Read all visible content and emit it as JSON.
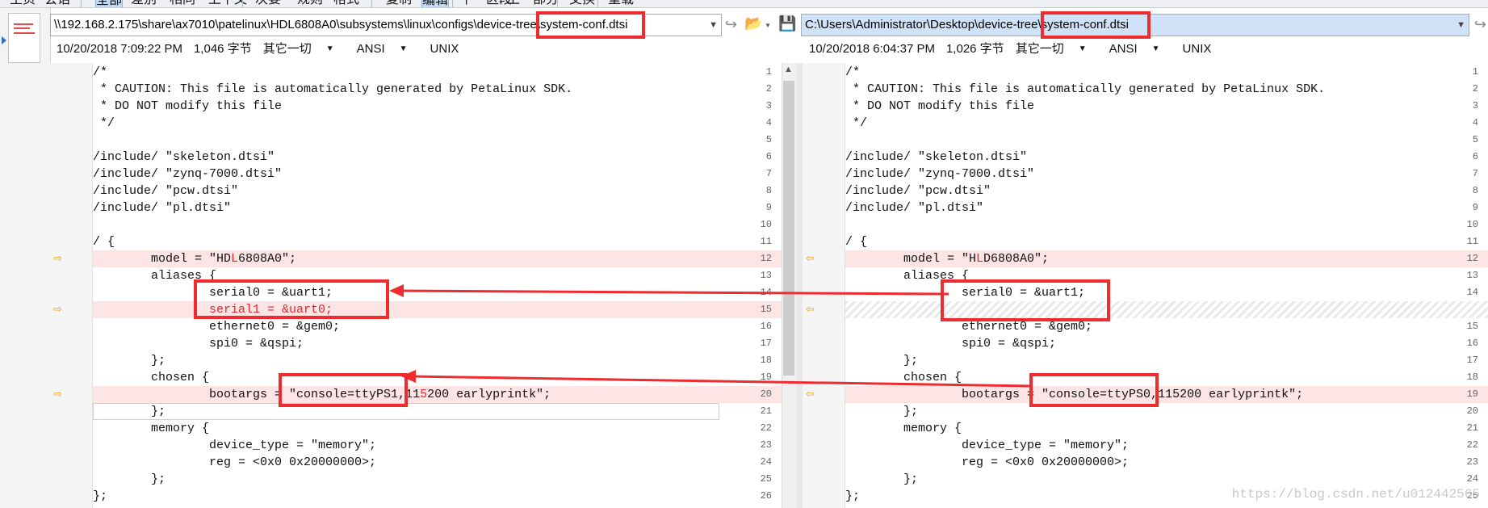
{
  "toolbar": {
    "buttons": [
      "主页",
      "会话",
      "全部",
      "差别",
      "相同",
      "上下文",
      "次要",
      "规则",
      "格式",
      "复制",
      "编辑",
      "下一区段",
      "上一部分",
      "交换",
      "重载"
    ],
    "selected": [
      "全部",
      "编辑"
    ]
  },
  "left_pane": {
    "path_prefix": "\\\\192.168.2.175\\share\\ax7010\\patelinux\\HDL6808A0\\subsystems\\linux\\configs\\device-tree\\",
    "path_file": "system-conf.dtsi",
    "timestamp": "10/20/2018 7:09:22 PM",
    "size": "1,046 字节",
    "other": "其它一切",
    "encoding": "ANSI",
    "line_end": "UNIX",
    "lines": [
      {
        "n": "1",
        "t": "/*"
      },
      {
        "n": "2",
        "t": " * CAUTION: This file is automatically generated by PetaLinux SDK."
      },
      {
        "n": "3",
        "t": " * DO NOT modify this file"
      },
      {
        "n": "4",
        "t": " */"
      },
      {
        "n": "5",
        "t": ""
      },
      {
        "n": "6",
        "t": "/include/ \"skeleton.dtsi\""
      },
      {
        "n": "7",
        "t": "/include/ \"zynq-7000.dtsi\""
      },
      {
        "n": "8",
        "t": "/include/ \"pcw.dtsi\""
      },
      {
        "n": "9",
        "t": "/include/ \"pl.dtsi\""
      },
      {
        "n": "10",
        "t": ""
      },
      {
        "n": "11",
        "t": "/ {"
      },
      {
        "n": "12",
        "t": "        model = \"HDL6808A0\";",
        "diff": true
      },
      {
        "n": "13",
        "t": "        aliases {"
      },
      {
        "n": "14",
        "t": "                serial0 = &uart1;"
      },
      {
        "n": "15",
        "t": "                serial1 = &uart0;",
        "diff": true,
        "allred": true
      },
      {
        "n": "16",
        "t": "                ethernet0 = &gem0;"
      },
      {
        "n": "17",
        "t": "                spi0 = &qspi;"
      },
      {
        "n": "18",
        "t": "        };"
      },
      {
        "n": "19",
        "t": "        chosen {"
      },
      {
        "n": "20",
        "t": "                bootargs = \"console=ttyPS1,115200 earlyprintk\";",
        "diff": true
      },
      {
        "n": "21",
        "t": "        };"
      },
      {
        "n": "22",
        "t": "        memory {"
      },
      {
        "n": "23",
        "t": "                device_type = \"memory\";"
      },
      {
        "n": "24",
        "t": "                reg = <0x0 0x20000000>;"
      },
      {
        "n": "25",
        "t": "        };"
      },
      {
        "n": "26",
        "t": "};"
      }
    ]
  },
  "right_pane": {
    "path_prefix": "C:\\Users\\Administrator\\Desktop\\device-tree\\",
    "path_file": "system-conf.dtsi",
    "timestamp": "10/20/2018 6:04:37 PM",
    "size": "1,026 字节",
    "other": "其它一切",
    "encoding": "ANSI",
    "line_end": "UNIX",
    "lines": [
      {
        "n": "1",
        "t": "/*"
      },
      {
        "n": "2",
        "t": " * CAUTION: This file is automatically generated by PetaLinux SDK."
      },
      {
        "n": "3",
        "t": " * DO NOT modify this file"
      },
      {
        "n": "4",
        "t": " */"
      },
      {
        "n": "5",
        "t": ""
      },
      {
        "n": "6",
        "t": "/include/ \"skeleton.dtsi\""
      },
      {
        "n": "7",
        "t": "/include/ \"zynq-7000.dtsi\""
      },
      {
        "n": "8",
        "t": "/include/ \"pcw.dtsi\""
      },
      {
        "n": "9",
        "t": "/include/ \"pl.dtsi\""
      },
      {
        "n": "10",
        "t": ""
      },
      {
        "n": "11",
        "t": "/ {"
      },
      {
        "n": "12",
        "t": "        model = \"HLD6808A0\";",
        "diff": true
      },
      {
        "n": "13",
        "t": "        aliases {"
      },
      {
        "n": "14",
        "t": "                serial0 = &uart1;"
      },
      {
        "n": "",
        "t": "",
        "missing": true
      },
      {
        "n": "15",
        "t": "                ethernet0 = &gem0;"
      },
      {
        "n": "16",
        "t": "                spi0 = &qspi;"
      },
      {
        "n": "17",
        "t": "        };"
      },
      {
        "n": "18",
        "t": "        chosen {"
      },
      {
        "n": "19",
        "t": "                bootargs = \"console=ttyPS0,115200 earlyprintk\";",
        "diff": true
      },
      {
        "n": "20",
        "t": "        };"
      },
      {
        "n": "21",
        "t": "        memory {"
      },
      {
        "n": "22",
        "t": "                device_type = \"memory\";"
      },
      {
        "n": "23",
        "t": "                reg = <0x0 0x20000000>;"
      },
      {
        "n": "24",
        "t": "        };"
      },
      {
        "n": "25",
        "t": "};"
      }
    ]
  },
  "watermark": "https://blog.csdn.net/u012442565",
  "colors": {
    "diff_bg": "#fde5e5",
    "diff_text": "#e0282e",
    "annotation": "#ee2b2f",
    "arrow": "#e8a400"
  }
}
